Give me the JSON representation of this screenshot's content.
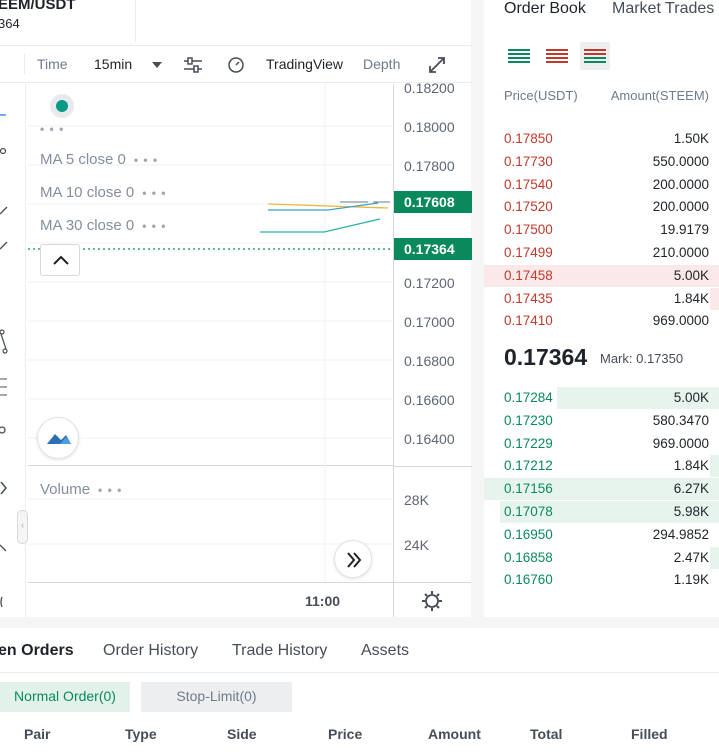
{
  "pair": {
    "name": "EEM/USDT",
    "price": "364"
  },
  "toolbar": {
    "time": "Time",
    "interval": "15min",
    "tradingview": "TradingView",
    "depth": "Depth"
  },
  "legend": {
    "ma5": "MA 5 close 0",
    "ma10": "MA 10 close 0",
    "ma30": "MA 30 close 0",
    "volume": "Volume"
  },
  "price_axis": {
    "ticks": [
      "0.18200",
      "0.18000",
      "0.17800",
      "0.17200",
      "0.17000",
      "0.16800",
      "0.16600",
      "0.16400"
    ],
    "tag_high": "0.17608",
    "tag_last": "0.17364"
  },
  "volume_axis": {
    "ticks": [
      "28K",
      "24K"
    ]
  },
  "time_axis": {
    "label": "11:00"
  },
  "orderbook": {
    "tabs": [
      "Order Book",
      "Market Trades"
    ],
    "headers": {
      "price": "Price(USDT)",
      "amount": "Amount(STEEM)"
    },
    "asks": [
      {
        "price": "0.17850",
        "amount": "1.50K",
        "depth": 0
      },
      {
        "price": "0.17730",
        "amount": "550.0000",
        "depth": 0
      },
      {
        "price": "0.17540",
        "amount": "200.0000",
        "depth": 0
      },
      {
        "price": "0.17520",
        "amount": "200.0000",
        "depth": 0
      },
      {
        "price": "0.17500",
        "amount": "19.9179",
        "depth": 0
      },
      {
        "price": "0.17499",
        "amount": "210.0000",
        "depth": 0
      },
      {
        "price": "0.17458",
        "amount": "5.00K",
        "depth": 1.0
      },
      {
        "price": "0.17435",
        "amount": "1.84K",
        "depth": 0.04
      },
      {
        "price": "0.17410",
        "amount": "969.0000",
        "depth": 0
      }
    ],
    "last_price": "0.17364",
    "mark": "Mark: 0.17350",
    "bids": [
      {
        "price": "0.17284",
        "amount": "5.00K",
        "depth": 0.69
      },
      {
        "price": "0.17230",
        "amount": "580.3470",
        "depth": 0
      },
      {
        "price": "0.17229",
        "amount": "969.0000",
        "depth": 0
      },
      {
        "price": "0.17212",
        "amount": "1.84K",
        "depth": 0.04
      },
      {
        "price": "0.17156",
        "amount": "6.27K",
        "depth": 1.0
      },
      {
        "price": "0.17078",
        "amount": "5.98K",
        "depth": 0.93
      },
      {
        "price": "0.16950",
        "amount": "294.9852",
        "depth": 0
      },
      {
        "price": "0.16858",
        "amount": "2.47K",
        "depth": 0.04
      },
      {
        "price": "0.16760",
        "amount": "1.19K",
        "depth": 0
      }
    ]
  },
  "bottom": {
    "tabs": [
      "en Orders",
      "Order History",
      "Trade History",
      "Assets"
    ],
    "chips": [
      "Normal Order(0)",
      "Stop-Limit(0)"
    ],
    "columns": [
      "Pair",
      "Type",
      "Side",
      "Price",
      "Amount",
      "Total",
      "Filled"
    ]
  },
  "colors": {
    "green": "#0a8a5c",
    "red": "#c0392b",
    "accent_bg": "#e7f4ee"
  }
}
